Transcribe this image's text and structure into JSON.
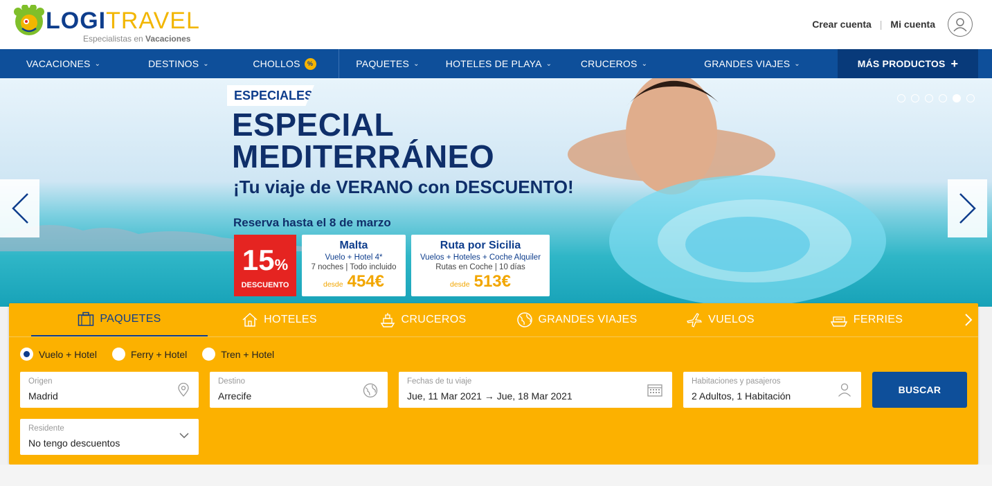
{
  "header": {
    "logo": {
      "word_a": "LOGI",
      "word_b": "TRAVEL",
      "tagline_a": "Especialistas en ",
      "tagline_b": "Vacaciones"
    },
    "create_account": "Crear cuenta",
    "my_account": "Mi cuenta",
    "separator": "|"
  },
  "nav": {
    "items": [
      {
        "label": "VACACIONES",
        "chevron": "chevron-down-icon"
      },
      {
        "label": "DESTINOS",
        "chevron": "chevron-down-icon"
      },
      {
        "label": "CHOLLOS",
        "badge": "%"
      },
      {
        "label": "PAQUETES",
        "chevron": "chevron-down-icon"
      },
      {
        "label": "HOTELES DE PLAYA",
        "chevron": "chevron-down-icon"
      },
      {
        "label": "CRUCEROS",
        "chevron": "chevron-down-icon"
      },
      {
        "label": "GRANDES VIAJES",
        "chevron": "chevron-down-icon"
      }
    ],
    "more": {
      "label": "MÁS PRODUCTOS",
      "icon": "+"
    }
  },
  "hero": {
    "badge": "ESPECIALES",
    "title_line1": "ESPECIAL",
    "title_line2": "MEDITERRÁNEO",
    "subtitle": "¡Tu viaje de VERANO con DESCUENTO!",
    "reserva": "Reserva hasta el 8 de marzo",
    "discount": {
      "number": "15",
      "percent": "%",
      "label": "DESCUENTO"
    },
    "deals": [
      {
        "name": "Malta",
        "sub": "Vuelo + Hotel 4*",
        "detail": "7 noches | Todo incluido",
        "desde": "desde",
        "price": "454€"
      },
      {
        "name": "Ruta por Sicilia",
        "sub": "Vuelos + Hoteles + Coche Alquiler",
        "detail": "Rutas en Coche | 10 días",
        "desde": "desde",
        "price": "513€"
      }
    ],
    "slides_total": 6,
    "slides_active": 5
  },
  "search": {
    "tabs": [
      {
        "label": "PAQUETES",
        "icon": "suitcase-icon",
        "active": true
      },
      {
        "label": "HOTELES",
        "icon": "house-icon"
      },
      {
        "label": "CRUCEROS",
        "icon": "ship-icon"
      },
      {
        "label": "GRANDES VIAJES",
        "icon": "globe-icon"
      },
      {
        "label": "VUELOS",
        "icon": "plane-icon"
      },
      {
        "label": "FERRIES",
        "icon": "ferry-icon"
      }
    ],
    "radios": [
      {
        "label": "Vuelo + Hotel",
        "checked": true
      },
      {
        "label": "Ferry + Hotel",
        "checked": false
      },
      {
        "label": "Tren + Hotel",
        "checked": false
      }
    ],
    "origin": {
      "label": "Origen",
      "value": "Madrid"
    },
    "destination": {
      "label": "Destino",
      "value": "Arrecife"
    },
    "dates": {
      "label": "Fechas de tu viaje",
      "value": "Jue, 11 Mar 2021 → Jue, 18 Mar 2021"
    },
    "rooms": {
      "label": "Habitaciones y pasajeros",
      "value": "2 Adultos,  1 Habitación"
    },
    "button": "BUSCAR",
    "resident": {
      "label": "Residente",
      "value": "No tengo descuentos"
    }
  },
  "colors": {
    "brand_blue": "#0e4f9a",
    "brand_yellow": "#fcb100",
    "discount_red": "#e52421"
  }
}
